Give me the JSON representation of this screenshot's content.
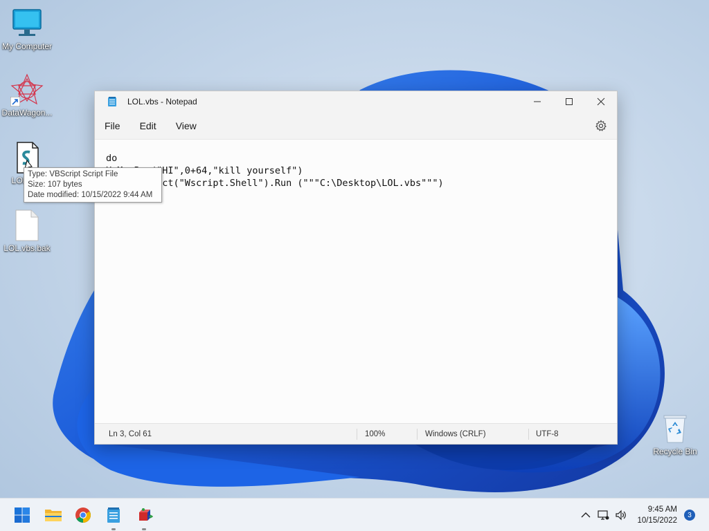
{
  "desktop": {
    "icons": [
      {
        "label": "My Computer",
        "icon": "monitor-icon"
      },
      {
        "label": "DataWagon...",
        "icon": "datawagon-icon"
      },
      {
        "label": "LOL.vbs",
        "icon": "vbscript-file-icon"
      },
      {
        "label": "LOL.vbs.bak",
        "icon": "blank-file-icon"
      },
      {
        "label": "Recycle Bin",
        "icon": "recycle-bin-icon"
      }
    ],
    "tooltip": {
      "type": "Type: VBScript Script File",
      "size": "Size: 107 bytes",
      "modified": "Date modified: 10/15/2022 9:44 AM"
    }
  },
  "window": {
    "title": "LOL.vbs - Notepad",
    "menu": [
      "File",
      "Edit",
      "View"
    ],
    "content": "do\nX=MsgBox(\"HI\",0+64,\"kill yourself\")\nCreateObject(\"Wscript.Shell\").Run (\"\"\"C:\\Desktop\\LOL.vbs\"\"\")",
    "status": {
      "position": "Ln 3, Col 61",
      "zoom": "100%",
      "line_endings": "Windows (CRLF)",
      "encoding": "UTF-8"
    }
  },
  "taskbar": {
    "apps": [
      "start-icon",
      "file-explorer-icon",
      "chrome-icon",
      "notepad-icon",
      "app-icon"
    ],
    "time": "9:45 AM",
    "date": "10/15/2022",
    "notification_count": "3"
  },
  "colors": {
    "accent": "#1f5fb8",
    "wallpaper_blue": "#1560e0"
  }
}
